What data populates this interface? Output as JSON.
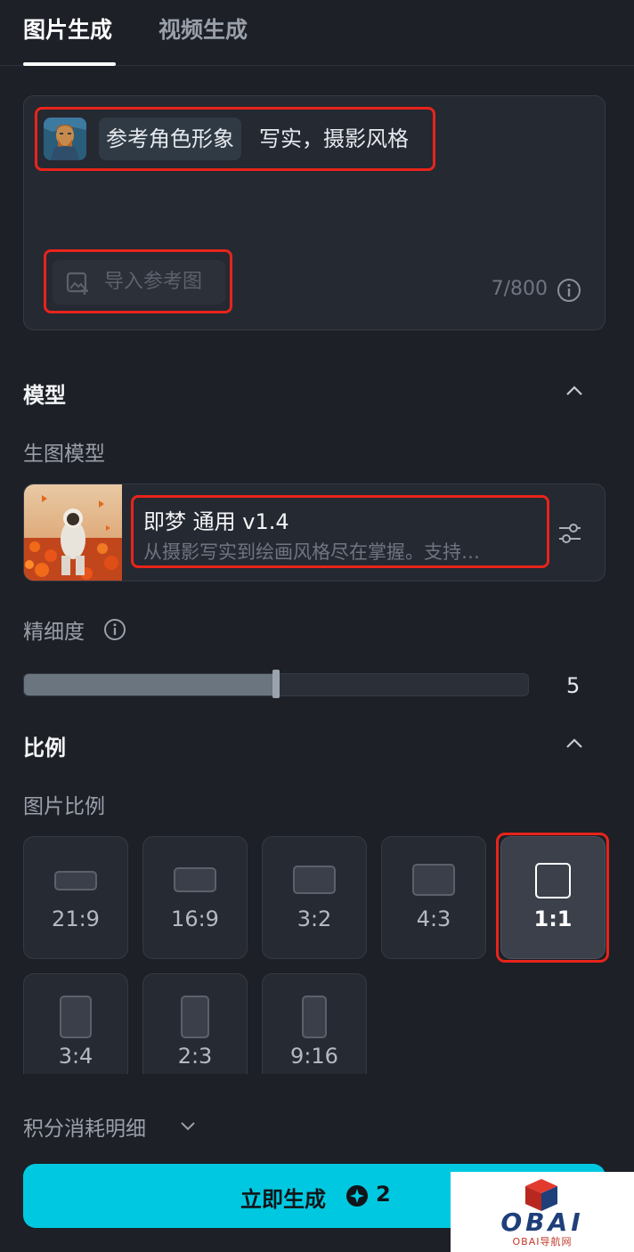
{
  "tabs": [
    {
      "label": "图片生成"
    },
    {
      "label": "视频生成"
    }
  ],
  "prompt": {
    "ref_chip": "参考角色形象",
    "text": "写实，摄影风格",
    "import_button": "导入参考图",
    "counter": "7/800"
  },
  "model_section": {
    "title": "模型",
    "sub_label": "生图模型",
    "model_name": "即梦 通用 v1.4",
    "model_desc": "从摄影写实到绘画风格尽在掌握。支持…"
  },
  "detail": {
    "label": "精细度",
    "value": "5",
    "level_fraction": 0.5
  },
  "ratio_section": {
    "title": "比例",
    "sub_label": "图片比例",
    "options": [
      "21:9",
      "16:9",
      "3:2",
      "4:3",
      "1:1",
      "3:4",
      "2:3",
      "9:16"
    ],
    "selected": "1:1"
  },
  "credits": {
    "label": "积分消耗明细"
  },
  "generate": {
    "label": "立即生成",
    "cost": "2"
  },
  "watermark": {
    "text": "OBAI",
    "sub": "OBAI导航网"
  },
  "colors": {
    "background": "#1d2027",
    "accent": "#00c8e0",
    "highlight": "#e8241b"
  }
}
